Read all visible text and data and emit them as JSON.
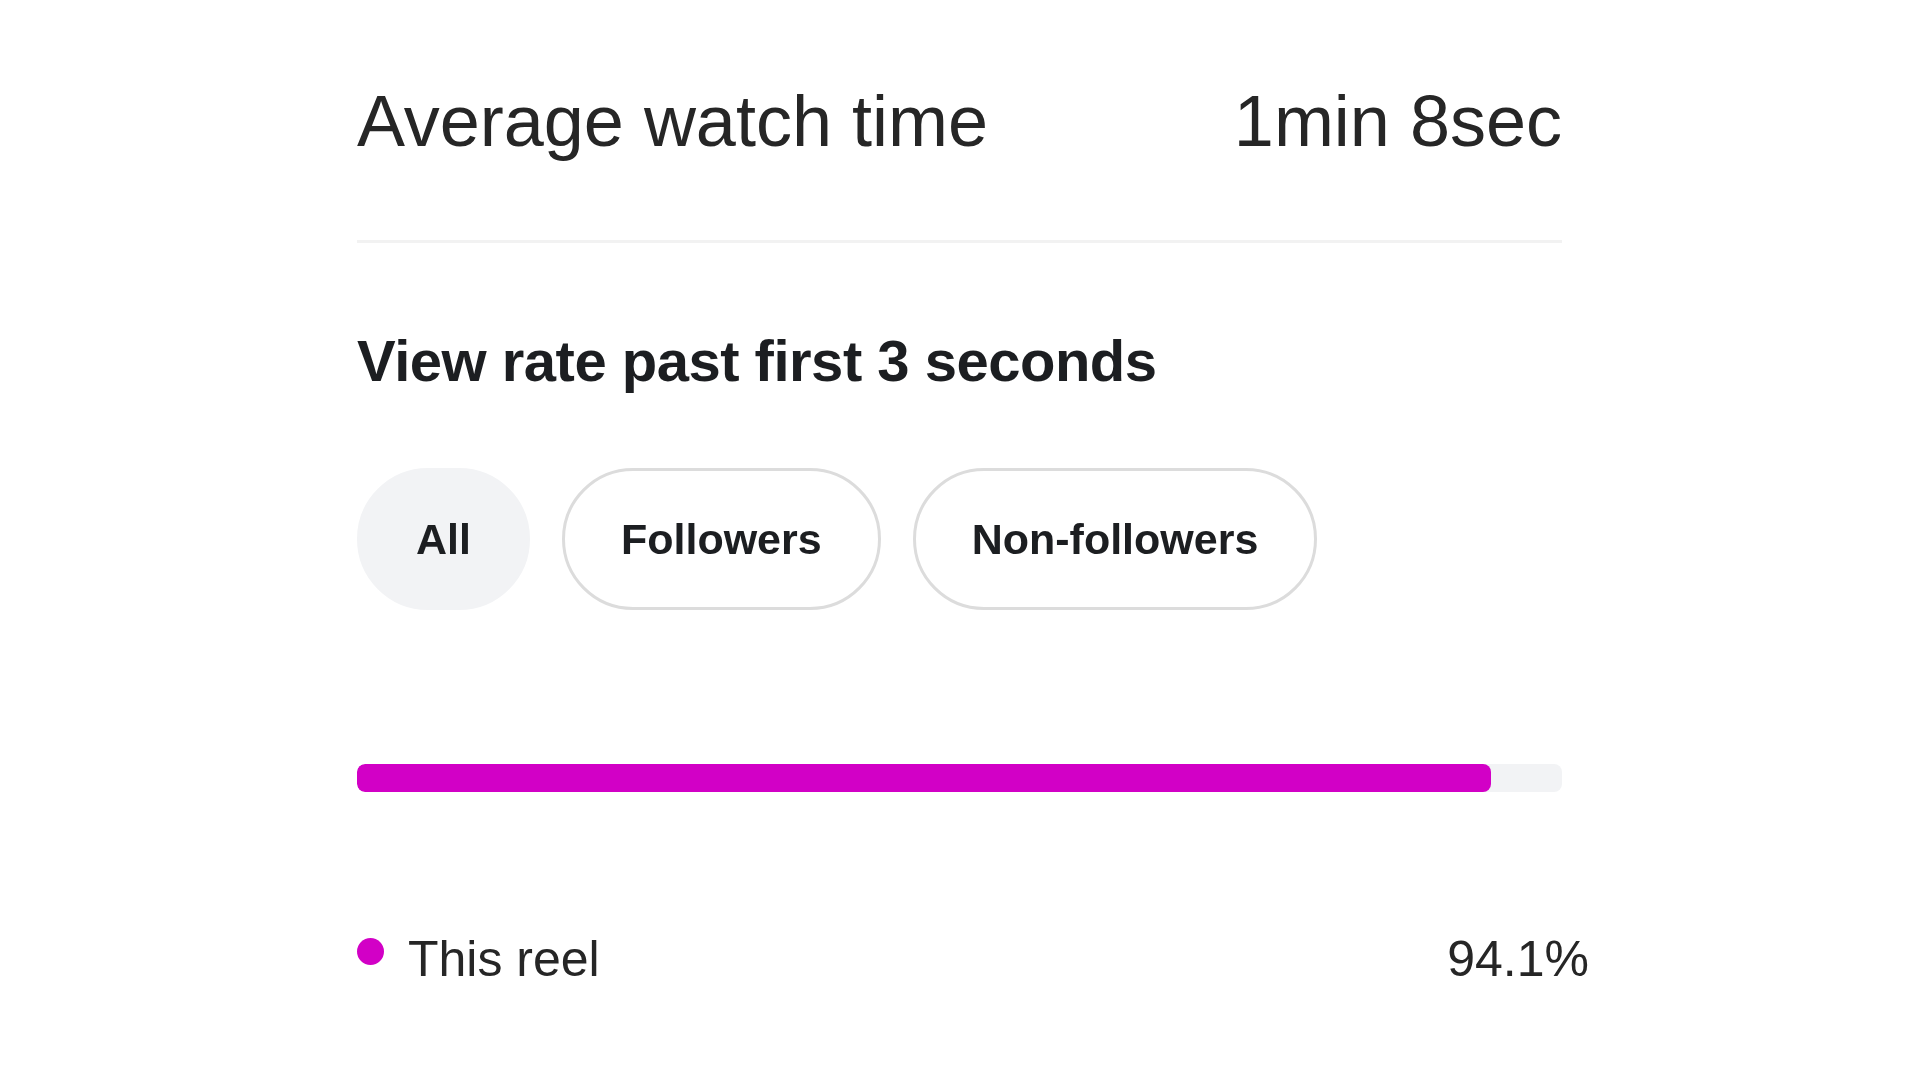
{
  "summary": {
    "label": "Average watch time",
    "value": "1min 8sec"
  },
  "view_rate": {
    "title": "View rate past first 3 seconds",
    "filters": [
      {
        "label": "All",
        "selected": true
      },
      {
        "label": "Followers",
        "selected": false
      },
      {
        "label": "Non-followers",
        "selected": false
      }
    ],
    "series": [
      {
        "name": "This reel",
        "value": "94.1%",
        "level": 0.941,
        "color": "#d200c6"
      }
    ]
  }
}
